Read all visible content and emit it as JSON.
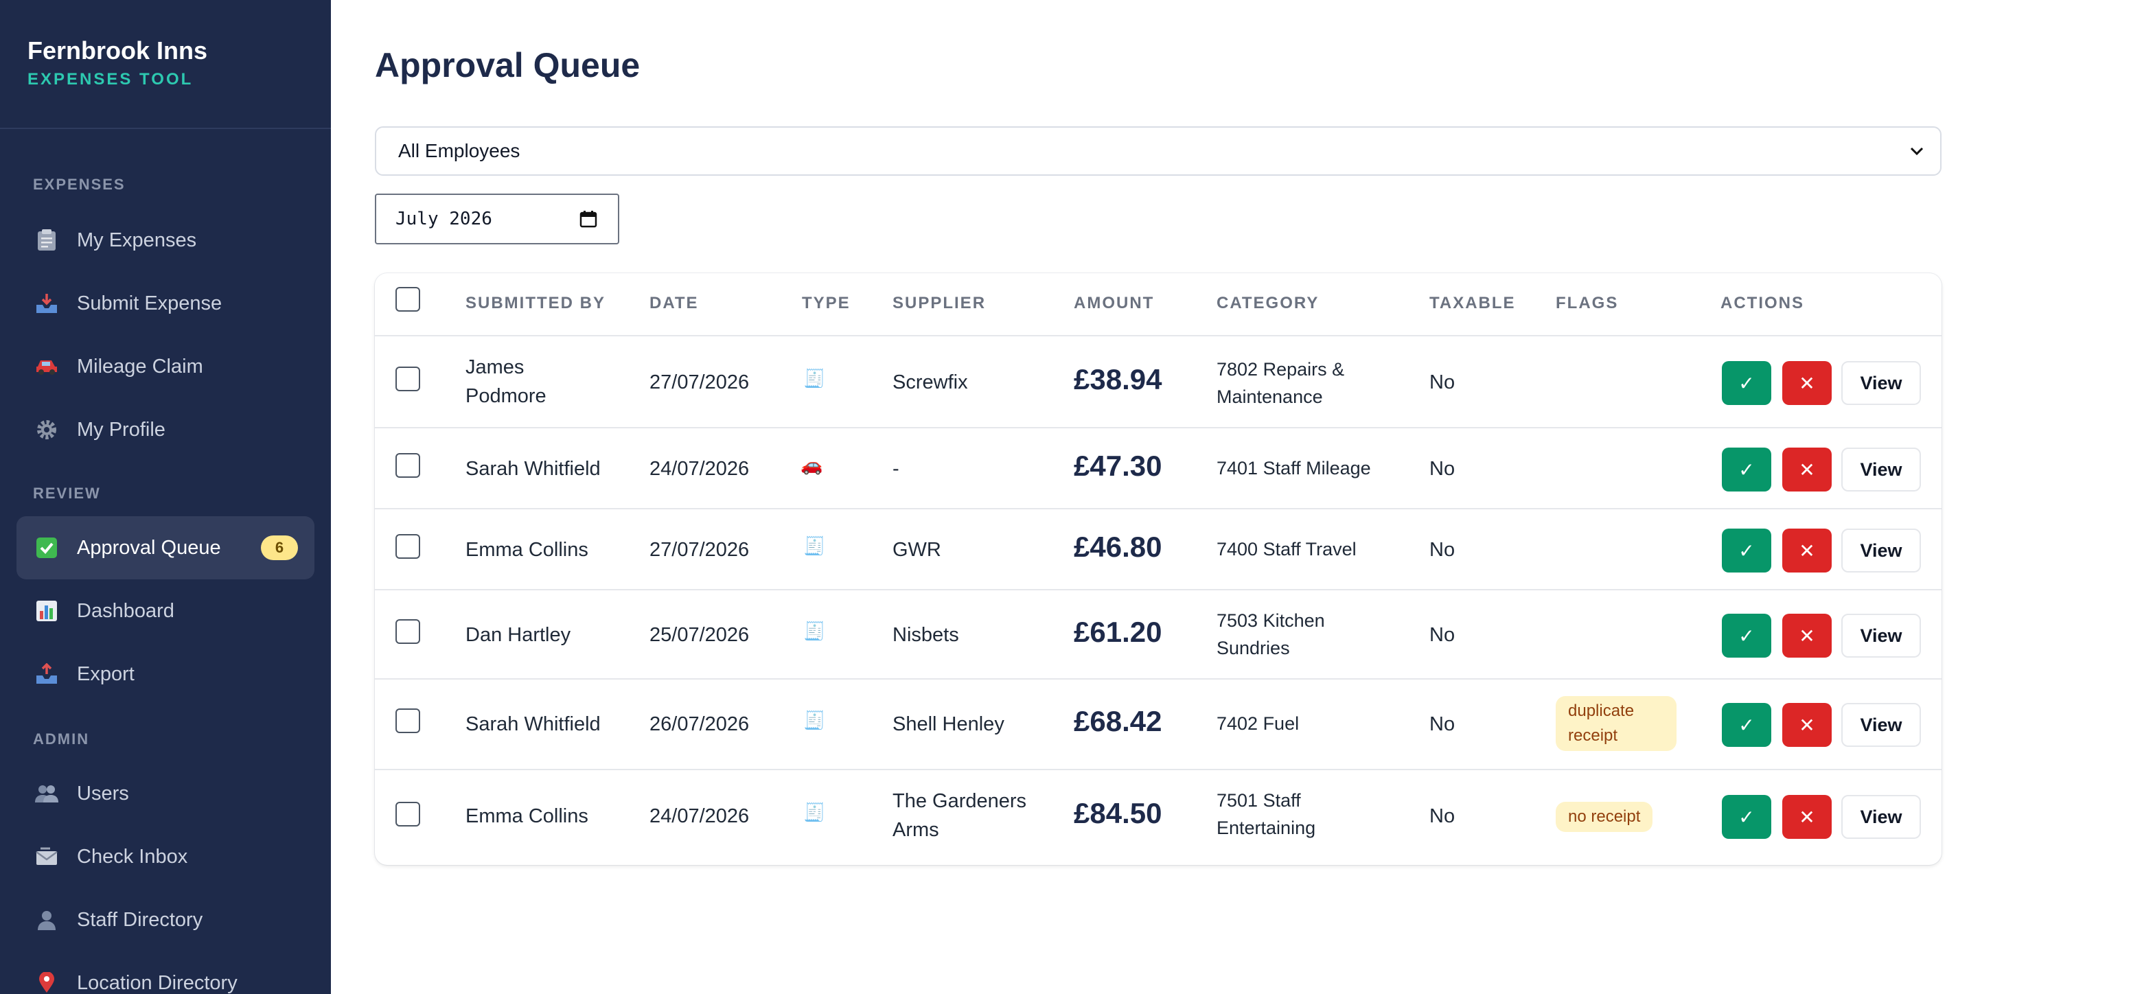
{
  "brand": {
    "name": "Fernbrook Inns",
    "subtitle": "EXPENSES TOOL"
  },
  "sidebar": {
    "sections": [
      {
        "title": "EXPENSES"
      },
      {
        "title": "REVIEW"
      },
      {
        "title": "ADMIN"
      }
    ],
    "items": [
      {
        "label": "My Expenses",
        "icon": "clipboard-icon"
      },
      {
        "label": "Submit Expense",
        "icon": "inbox-tray-icon"
      },
      {
        "label": "Mileage Claim",
        "icon": "car-icon"
      },
      {
        "label": "My Profile",
        "icon": "gear-icon"
      },
      {
        "label": "Approval Queue",
        "icon": "check-box-icon",
        "badge": "6",
        "active": true
      },
      {
        "label": "Dashboard",
        "icon": "bar-chart-icon"
      },
      {
        "label": "Export",
        "icon": "outbox-tray-icon"
      },
      {
        "label": "Users",
        "icon": "users-icon"
      },
      {
        "label": "Check Inbox",
        "icon": "incoming-envelope-icon"
      },
      {
        "label": "Staff Directory",
        "icon": "person-icon"
      },
      {
        "label": "Location Directory",
        "icon": "pin-icon"
      }
    ]
  },
  "main": {
    "title": "Approval Queue",
    "employee_filter": {
      "selected": "All Employees"
    },
    "month_filter": {
      "value": "July 2026"
    },
    "table": {
      "headers": [
        "SUBMITTED BY",
        "DATE",
        "TYPE",
        "SUPPLIER",
        "AMOUNT",
        "CATEGORY",
        "TAXABLE",
        "FLAGS",
        "ACTIONS"
      ],
      "rows": [
        {
          "submitted_by": "James Podmore",
          "date": "27/07/2026",
          "type": "receipt-icon",
          "type_glyph": "🧾",
          "supplier": "Screwfix",
          "amount": "£38.94",
          "category": "7802 Repairs & Maintenance",
          "taxable": "No",
          "flag": ""
        },
        {
          "submitted_by": "Sarah Whitfield",
          "date": "24/07/2026",
          "type": "car-icon",
          "type_glyph": "🚗",
          "supplier": "-",
          "amount": "£47.30",
          "category": "7401 Staff Mileage",
          "taxable": "No",
          "flag": ""
        },
        {
          "submitted_by": "Emma Collins",
          "date": "27/07/2026",
          "type": "receipt-icon",
          "type_glyph": "🧾",
          "supplier": "GWR",
          "amount": "£46.80",
          "category": "7400 Staff Travel",
          "taxable": "No",
          "flag": ""
        },
        {
          "submitted_by": "Dan Hartley",
          "date": "25/07/2026",
          "type": "receipt-icon",
          "type_glyph": "🧾",
          "supplier": "Nisbets",
          "amount": "£61.20",
          "category": "7503 Kitchen Sundries",
          "taxable": "No",
          "flag": ""
        },
        {
          "submitted_by": "Sarah Whitfield",
          "date": "26/07/2026",
          "type": "receipt-icon",
          "type_glyph": "🧾",
          "supplier": "Shell Henley",
          "amount": "£68.42",
          "category": "7402 Fuel",
          "taxable": "No",
          "flag": "duplicate receipt"
        },
        {
          "submitted_by": "Emma Collins",
          "date": "24/07/2026",
          "type": "receipt-icon",
          "type_glyph": "🧾",
          "supplier": "The Gardeners Arms",
          "amount": "£84.50",
          "category": "7501 Staff Entertaining",
          "taxable": "No",
          "flag": "no receipt"
        }
      ],
      "actions": {
        "approve": "✓",
        "reject": "✕",
        "view": "View"
      }
    }
  },
  "colors": {
    "sidebar_bg": "#1e2a4a",
    "accent": "#2dc9b0",
    "approve": "#079669",
    "reject": "#dc2626",
    "flag_bg": "#fef3c7"
  }
}
